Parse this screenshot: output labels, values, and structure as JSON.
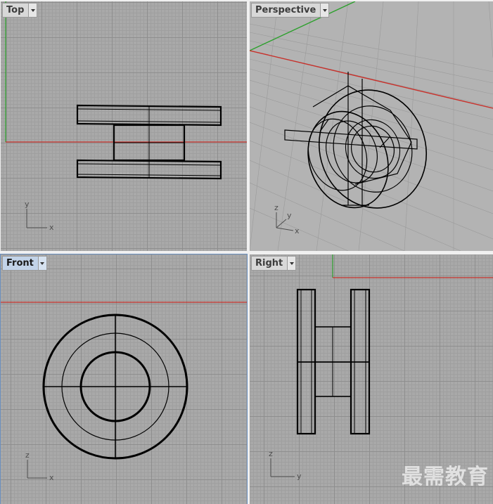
{
  "viewports": {
    "top": {
      "label": "Top",
      "axis_x": "x",
      "axis_y": "y"
    },
    "perspective": {
      "label": "Perspective",
      "axis_x": "x",
      "axis_y": "y",
      "axis_z": "z"
    },
    "front": {
      "label": "Front",
      "axis_x": "x",
      "axis_y": "z"
    },
    "right": {
      "label": "Right",
      "axis_x": "y",
      "axis_y": "z"
    }
  },
  "active_viewport": "front",
  "colors": {
    "x_axis": "#c8312b",
    "y_axis": "#2ba02b",
    "wire": "#000000",
    "grid_bg": "#a9a9a9",
    "tab_active": "#c2d3e8"
  },
  "watermark": "最需教育",
  "icons": {
    "dropdown": "triangle-down-icon"
  }
}
